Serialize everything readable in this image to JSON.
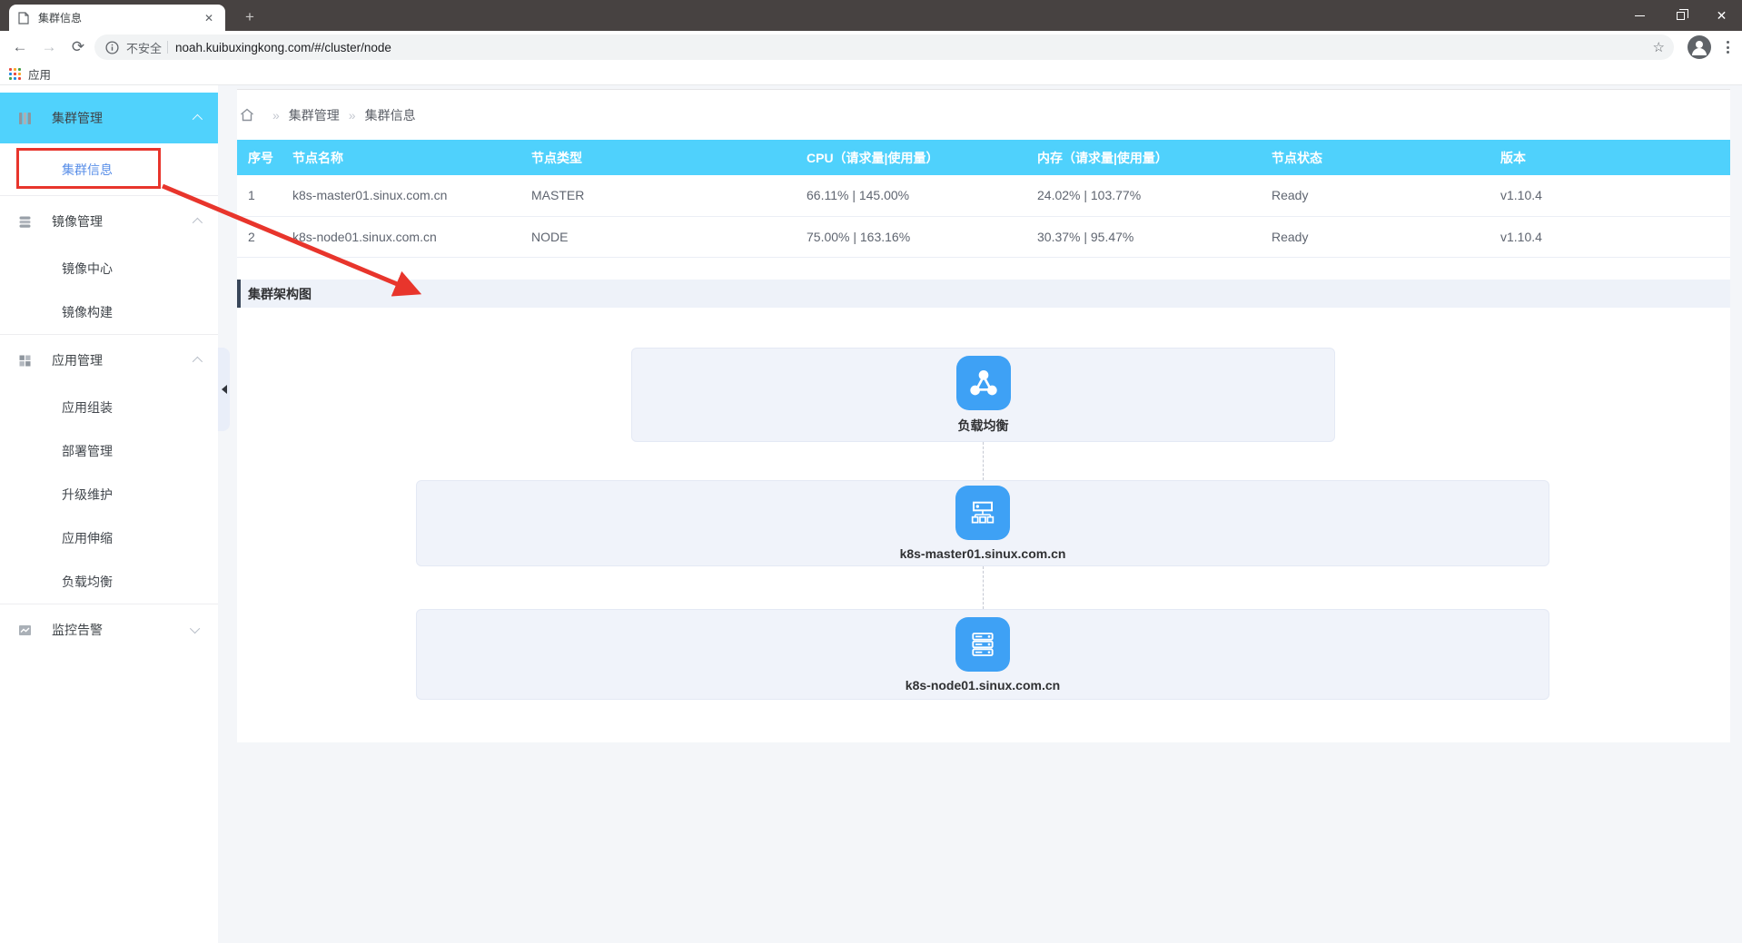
{
  "browser": {
    "tab_title": "集群信息",
    "new_tab_label": "+",
    "security_label": "不安全",
    "url": "noah.kuibuxingkong.com/#/cluster/node",
    "bookmarks": {
      "apps_label": "应用"
    }
  },
  "sidebar": {
    "groups": [
      {
        "label": "集群管理",
        "icon": "cluster-icon",
        "state": "expanded-active"
      },
      {
        "label": "镜像管理",
        "icon": "images-icon",
        "state": "expanded"
      },
      {
        "label": "应用管理",
        "icon": "apps-icon",
        "state": "expanded"
      },
      {
        "label": "监控告警",
        "icon": "monitor-icon",
        "state": "collapsed"
      }
    ],
    "items": {
      "cluster_info": "集群信息",
      "image_center": "镜像中心",
      "image_build": "镜像构建",
      "app_assembly": "应用组装",
      "deploy_mgmt": "部署管理",
      "upgrade_maint": "升级维护",
      "app_scaling": "应用伸缩",
      "load_balance": "负载均衡",
      "monitor_alert": "监控告警"
    }
  },
  "breadcrumb": {
    "level1": "集群管理",
    "level2": "集群信息"
  },
  "table": {
    "headers": [
      "序号",
      "节点名称",
      "节点类型",
      "CPU（请求量|使用量）",
      "内存（请求量|使用量）",
      "节点状态",
      "版本"
    ],
    "rows": [
      [
        "1",
        "k8s-master01.sinux.com.cn",
        "MASTER",
        "66.11% | 145.00%",
        "24.02% | 103.77%",
        "Ready",
        "v1.10.4"
      ],
      [
        "2",
        "k8s-node01.sinux.com.cn",
        "NODE",
        "75.00% | 163.16%",
        "30.37% | 95.47%",
        "Ready",
        "v1.10.4"
      ]
    ]
  },
  "architecture": {
    "title": "集群架构图",
    "nodes": [
      {
        "label": "负载均衡",
        "icon": "load-balancer-icon"
      },
      {
        "label": "k8s-master01.sinux.com.cn",
        "icon": "master-node-icon"
      },
      {
        "label": "k8s-node01.sinux.com.cn",
        "icon": "worker-node-icon"
      }
    ]
  },
  "colors": {
    "titlebar": "#474241",
    "sidebar_active_bg": "#50d2fc",
    "table_header_bg": "#4fd1fc",
    "submenu_active_text": "#5a8fe8",
    "node_icon_blue": "#3ea1f5",
    "card_bg": "#f0f3fa",
    "section_header_bg": "#eef2f9",
    "annotation_red": "#e8352c"
  }
}
